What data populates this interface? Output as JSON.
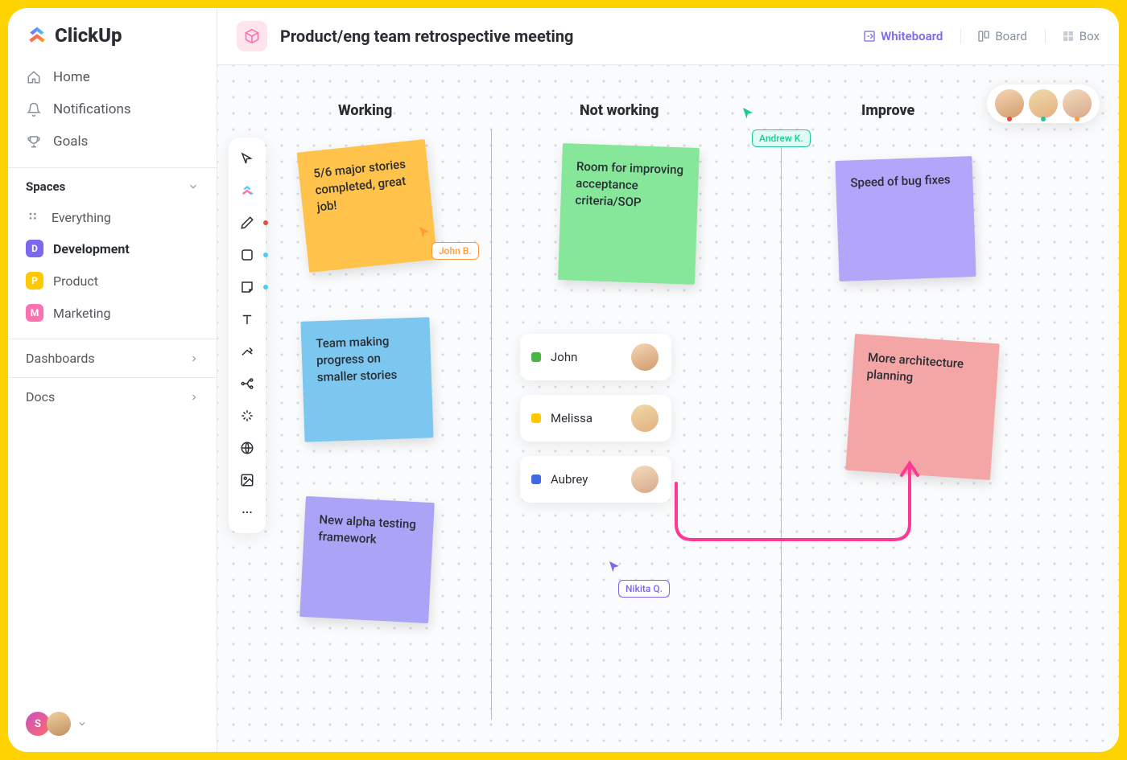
{
  "brand": {
    "name": "ClickUp"
  },
  "nav": {
    "home": "Home",
    "notifications": "Notifications",
    "goals": "Goals"
  },
  "spaces": {
    "header": "Spaces",
    "everything": "Everything",
    "items": [
      {
        "badge": "D",
        "label": "Development",
        "color": "#7b68ee",
        "active": true
      },
      {
        "badge": "P",
        "label": "Product",
        "color": "#ffc800",
        "active": false
      },
      {
        "badge": "M",
        "label": "Marketing",
        "color": "#fd71af",
        "active": false
      }
    ]
  },
  "collapse": {
    "dashboards": "Dashboards",
    "docs": "Docs"
  },
  "user_footer": {
    "initial": "S"
  },
  "page": {
    "title": "Product/eng team retrospective meeting",
    "views": [
      {
        "label": "Whiteboard",
        "active": true
      },
      {
        "label": "Board",
        "active": false
      },
      {
        "label": "Box",
        "active": false
      }
    ]
  },
  "columns": {
    "working": "Working",
    "not_working": "Not working",
    "improve": "Improve"
  },
  "stickies": {
    "s1": "5/6 major stories completed, great job!",
    "s2": "Team making progress on smaller stories",
    "s3": "New alpha testing framework",
    "s4": "Room for improving acceptance criteria/SOP",
    "s5": "Speed of bug fixes",
    "s6": "More architecture planning"
  },
  "cursors": {
    "john": "John B.",
    "andrew": "Andrew K.",
    "nikita": "Nikita Q."
  },
  "user_cards": [
    {
      "name": "John",
      "color": "#4ab449"
    },
    {
      "name": "Melissa",
      "color": "#ffc800"
    },
    {
      "name": "Aubrey",
      "color": "#4169e1"
    }
  ],
  "tools": [
    "pointer",
    "clickup",
    "pen",
    "square",
    "note",
    "text",
    "connector",
    "branch",
    "sparkle",
    "globe",
    "image",
    "more"
  ],
  "colors": {
    "accent": "#7b68ee",
    "yellow": "#ffd166",
    "blue": "#8ecae6",
    "green": "#80ed99",
    "violet": "#c8b6ff",
    "pink": "#f4a6a6"
  }
}
